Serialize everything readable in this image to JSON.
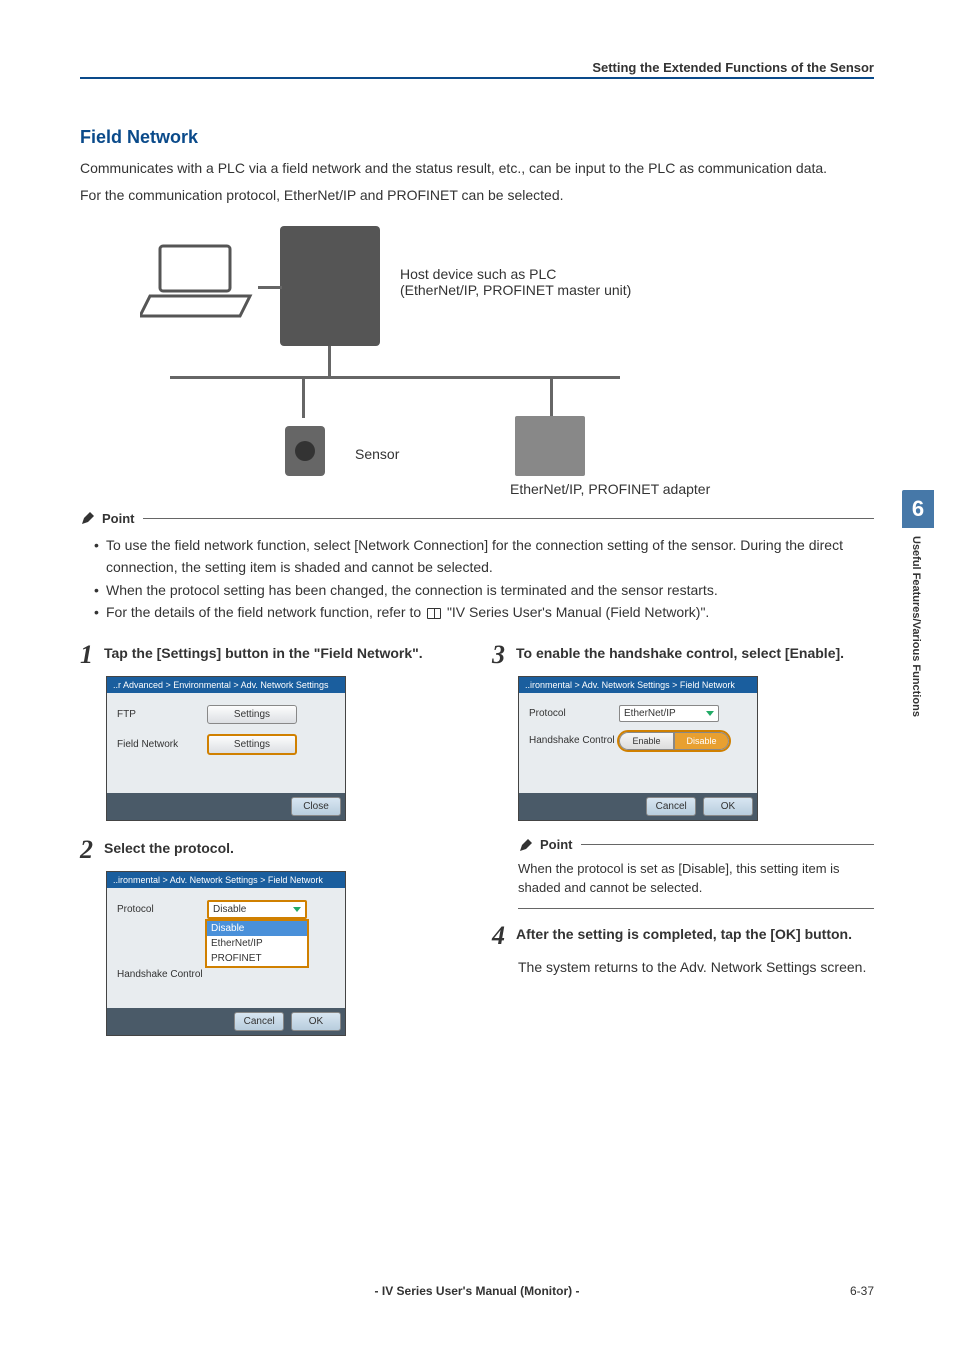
{
  "header": {
    "title": "Setting the Extended Functions of the Sensor"
  },
  "section": {
    "title": "Field Network"
  },
  "intro": {
    "p1": "Communicates with a PLC via a field network and the status result, etc., can be input to the PLC as communication data.",
    "p2": "For the communication protocol, EtherNet/IP and PROFINET can be selected."
  },
  "diagram": {
    "host_label_l1": "Host device such as PLC",
    "host_label_l2": "(EtherNet/IP, PROFINET master unit)",
    "sensor_label": "Sensor",
    "adapter_label": "EtherNet/IP, PROFINET adapter"
  },
  "point_label": "Point",
  "points": {
    "b1": "To use the field network function, select [Network Connection] for the connection setting of the sensor. During the direct connection, the setting item is shaded and cannot be selected.",
    "b2": "When the protocol setting has been changed, the connection is terminated and the sensor restarts.",
    "b3_pre": "For the details of the field network function, refer to ",
    "b3_post": " \"IV Series User's Manual (Field Network)\"."
  },
  "steps": {
    "s1": {
      "num": "1",
      "text": "Tap the [Settings] button in the \"Field Network\"."
    },
    "s2": {
      "num": "2",
      "text": "Select the protocol."
    },
    "s3": {
      "num": "3",
      "text": "To enable the handshake control, select [Enable]."
    },
    "s4": {
      "num": "4",
      "text": "After the setting is completed, tap the [OK] button."
    }
  },
  "panel1": {
    "breadcrumb": "..r Advanced > Environmental > Adv. Network Settings",
    "row1_label": "FTP",
    "row1_btn": "Settings",
    "row2_label": "Field Network",
    "row2_btn": "Settings",
    "footer_close": "Close"
  },
  "panel2": {
    "breadcrumb": "..ironmental > Adv. Network Settings > Field Network",
    "row1_label": "Protocol",
    "row2_label": "Handshake Control",
    "select_value": "Disable",
    "options": {
      "o1": "Disable",
      "o2": "EtherNet/IP",
      "o3": "PROFINET"
    },
    "footer_cancel": "Cancel",
    "footer_ok": "OK"
  },
  "panel3": {
    "breadcrumb": "..ironmental > Adv. Network Settings > Field Network",
    "row1_label": "Protocol",
    "row2_label": "Handshake Control",
    "select_value": "EtherNet/IP",
    "toggle_on": "Enable",
    "toggle_off": "Disable",
    "footer_cancel": "Cancel",
    "footer_ok": "OK"
  },
  "step3_point": "When the protocol is set as [Disable], this setting item is shaded and cannot be selected.",
  "step4_follow": "The system returns to the Adv. Network Settings screen.",
  "sidebar": {
    "chapter_num": "6",
    "chapter_title": "Useful Features/Various Functions"
  },
  "footer": {
    "manual": "- IV Series User's Manual (Monitor) -",
    "page": "6-37"
  }
}
